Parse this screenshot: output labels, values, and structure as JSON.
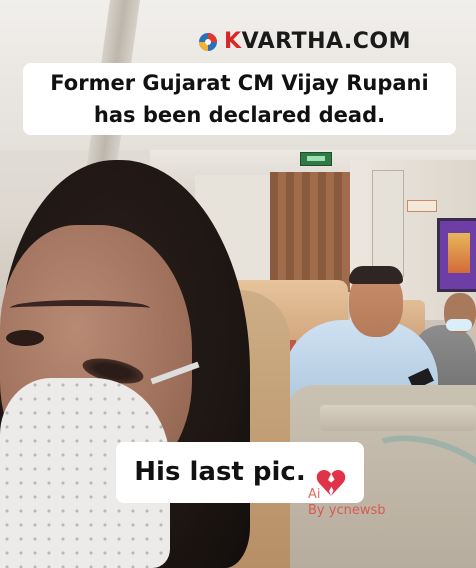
{
  "watermark": {
    "logo_letter": "K",
    "logo_rest": "VARTHA.COM",
    "logo_icon": "kvartha-globe-icon",
    "brand_color": "#d62828"
  },
  "captions": {
    "headline": "Former Gujarat CM Vijay Rupani has been declared dead.",
    "subtitle": "His last pic.",
    "subtitle_icon": "broken-heart-icon"
  },
  "credit": {
    "line1": "Ai",
    "line2": "By ycnewsb"
  },
  "colors": {
    "caption_bg": "#ffffff",
    "caption_text": "#111111",
    "heart": "#e0334a"
  }
}
